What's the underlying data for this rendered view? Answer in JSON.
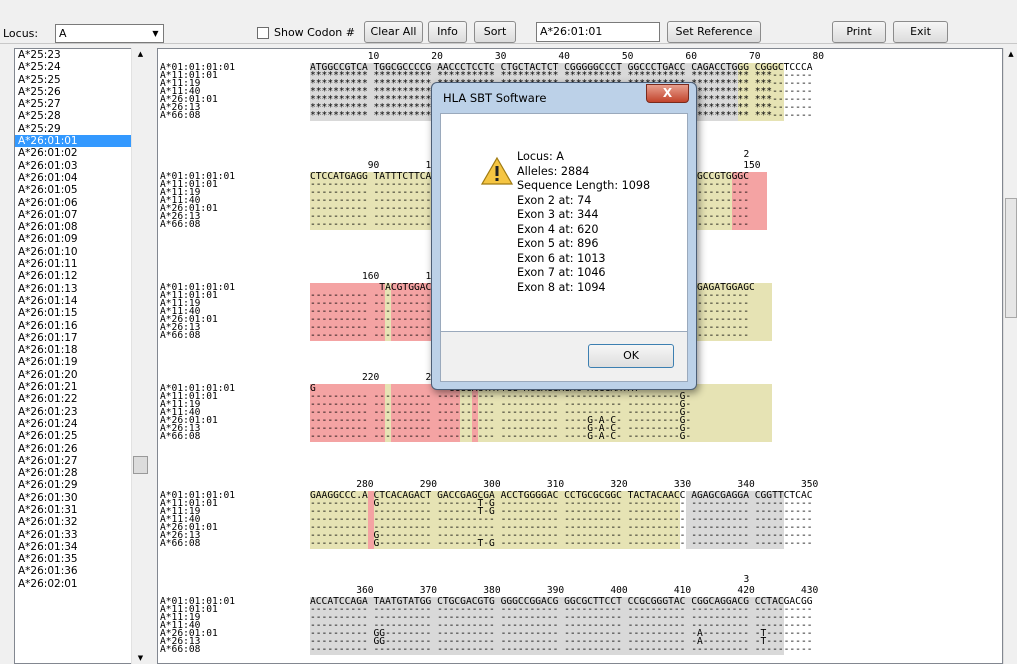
{
  "toolbar": {
    "locus_label": "Locus:",
    "locus_value": "A",
    "show_codon_label": "Show Codon #",
    "clear_all": "Clear All",
    "info": "Info",
    "sort": "Sort",
    "reference_value": "A*26:01:01",
    "set_reference": "Set Reference",
    "print": "Print",
    "exit": "Exit"
  },
  "allele_list": [
    "A*25:23",
    "A*25:24",
    "A*25:25",
    "A*25:26",
    "A*25:27",
    "A*25:28",
    "A*25:29",
    "A*26:01:01",
    "A*26:01:02",
    "A*26:01:03",
    "A*26:01:04",
    "A*26:01:05",
    "A*26:01:06",
    "A*26:01:07",
    "A*26:01:08",
    "A*26:01:09",
    "A*26:01:10",
    "A*26:01:11",
    "A*26:01:12",
    "A*26:01:13",
    "A*26:01:14",
    "A*26:01:15",
    "A*26:01:16",
    "A*26:01:17",
    "A*26:01:18",
    "A*26:01:19",
    "A*26:01:20",
    "A*26:01:21",
    "A*26:01:22",
    "A*26:01:23",
    "A*26:01:24",
    "A*26:01:25",
    "A*26:01:26",
    "A*26:01:27",
    "A*26:01:28",
    "A*26:01:29",
    "A*26:01:30",
    "A*26:01:31",
    "A*26:01:32",
    "A*26:01:33",
    "A*26:01:34",
    "A*26:01:35",
    "A*26:01:36",
    "A*26:02:01"
  ],
  "selected_allele": "A*26:01:01",
  "allele_names": [
    "A*01:01:01:01",
    "A*11:01:01",
    "A*11:19",
    "A*11:40",
    "A*26:01:01",
    "A*26:13",
    "A*66:08"
  ],
  "blocks": [
    {
      "ruler": "          10         20         30         40         50         60         70         80",
      "rows": [
        "ATGGCCGTCA TGGCGCCCCG AACCCTCCTC CTGCTACTCT CGGGGGCCCT GGCCCTGACC CAGACCTGGG CGGGCTCCCA",
        "********** ********** ********** ********** ********** ********** ********** ***-------",
        "********** ********** ********** ********** ********** ********** ********** ***-------",
        "********** ********** ********** ********** ********** ********** ********** ***-------",
        "********** ********** ********** ********** ********** ********** ********** ***-------",
        "********** ********** ********** ********** ********** ********** ********** ***-------",
        "********** ********** ********** ********** ********** ********** ********** ***-------"
      ]
    },
    {
      "ruler": "          90        100        110        120        130        140        150",
      "marker": "2",
      "rows": [
        "CTCCATGAGG TATTTCTTCA CATCCGTGTC CCGGCCCGGC CGCGGGGAGC CCCGCTTCAT CGCCGTGGGC",
        "---------- ---------- ---------- ---------- ---------- ---------- ----------",
        "---------- ---------- ---------- ---------- ---------- ---------- ----------",
        "---------- ---------- ---------- ---------- ---------- ---------- ----------",
        "---------- ---------- ---------- ---------- ---------- ---------- ----------",
        "---------- ---------- ---------- ---------- ---------- ---------- ----------",
        "---------- ---------- ---------- ---------- ---------- ---------- ----------"
      ]
    },
    {
      "ruler": "         160        170        180        190        200        210",
      "rows": [
        "            TACGTGGACG ACACGCAGTT CGTGCGGTTC GACAGCGACG CCGCGAGCCA GAGATGGAGC",
        "---------- ---------- ---------- ---------- ---------- ---------- G---------",
        "---------- ---------- ---------- ---------- ---------- ---------- G---------",
        "---------- ---------- ---------- ---------- ---------- ---------- G---------",
        "---------- ---------- ---------- ---------- ---------- ---------- G---------",
        "---------- ---------- ---------- ---------- ---------- ---------- G---------",
        "---------- ---------- ---------- ---------- ---------- ---------- G---------"
      ]
    },
    {
      "ruler": "         220        230        240        250        260        270",
      "rows": [
        "G                       CCGGAGTATTGG ACCAGGAGAC ACGGAATAT",
        "---------- ---------- ---------- ---------- ---------- ---------G-",
        "---------- ---------- ---------- ---------- ---------- ---------G-",
        "---------- ---------- ---------- ---------- ---------- ---------G-",
        "---------- ---------- ---------- ---------- ----G-A-C- ---------G-",
        "---------- ---------- ---------- ---------- ----G-A-C- ---------G-",
        "---------- ---------- ---------- ---------- ----G-A-C- ---------G-"
      ]
    },
    {
      "ruler": "        280        290        300        310        320        330        340        350",
      "rows": [
        "GAAGGCCC.A CTCACAGACT GACCGAGCGA ACCTGGGGAC CCTGCGCGGC TACTACAACC AGAGCGAGGA CGGTTCTCAC",
        "---------- G--------- -------T-G ---------- ---------- ---------- ---------- ----------",
        "---------- ---------- -------T-G ---------- ---------- ---------- ---------- ----------",
        "---------- ---------- ---------- ---------- ---------- ---------- ---------- ----------",
        "---------- ---------- ---------- ---------- ---------- ---------- ---------- ----------",
        "---------- G--------- ---------- ---------- ---------- ---------- ---------- ----------",
        "---------- G--------- -------T-G ---------- ---------- ---------- ---------- ----------"
      ]
    },
    {
      "ruler": "        360        370        380        390        400        410        420        430",
      "marker": "3",
      "rows": [
        "ACCATCCAGA TAATGTATGG CTGCGACGTG GGGCCGGACG GGCGCTTCCT CCGCGGGTAC CGGCAGGACG CCTACGACGG",
        "---------- ---------- ---------- ---------- ---------- ---------- ---------- ----------",
        "---------- ---------- ---------- ---------- ---------- ---------- ---------- ----------",
        "---------- ---------- ---------- ---------- ---------- ---------- ---------- ----------",
        "---------- GG-------- ---------- ---------- ---------- ---------- -A-------- -T--------",
        "---------- GG-------- ---------- ---------- ---------- ---------- -A-------- -T--------",
        "---------- ---------- ---------- ---------- ---------- ---------- ---------- ----------"
      ]
    }
  ],
  "dialog": {
    "title": "HLA SBT Software",
    "close": "X",
    "lines": [
      "Locus: A",
      "Alleles: 2884",
      "Sequence Length: 1098",
      "Exon 2 at: 74",
      "Exon 3 at: 344",
      "Exon 4 at: 620",
      "Exon 5 at: 896",
      "Exon 6 at: 1013",
      "Exon 7 at: 1046",
      "Exon 8 at: 1094"
    ],
    "ok": "OK"
  },
  "colors": {
    "exon": "#e6e3b4",
    "mismatch": "#f4a3a3",
    "intron": "#d9d9d9",
    "selection": "#3399ff"
  }
}
